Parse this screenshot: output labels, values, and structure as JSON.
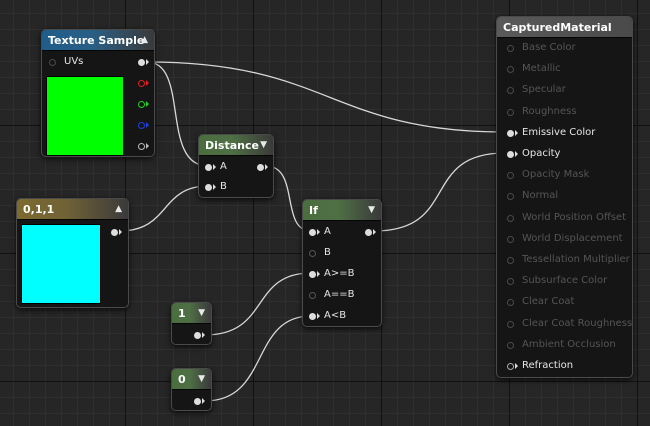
{
  "nodes": {
    "texture_sample": {
      "title": "Texture Sample",
      "input_uvs": "UVs",
      "preview_color": "#00ff00"
    },
    "distance": {
      "title": "Distance",
      "input_a": "A",
      "input_b": "B"
    },
    "constant3": {
      "title": "0,1,1",
      "preview_color": "#00ffff"
    },
    "if_node": {
      "title": "If",
      "inputs": [
        "A",
        "B",
        "A>=B",
        "A==B",
        "A<B"
      ]
    },
    "const_one": {
      "title": "1"
    },
    "const_zero": {
      "title": "0"
    },
    "material": {
      "title": "CapturedMaterial",
      "inputs": [
        "Base Color",
        "Metallic",
        "Specular",
        "Roughness",
        "Emissive Color",
        "Opacity",
        "Opacity Mask",
        "Normal",
        "World Position Offset",
        "World Displacement",
        "Tessellation Multiplier",
        "Subsurface Color",
        "Clear Coat",
        "Clear Coat Roughness",
        "Ambient Occlusion",
        "Refraction"
      ],
      "connected": [
        4,
        5,
        15
      ]
    }
  },
  "colors": {
    "wire": "#d8d8d8",
    "pin_r": "#e02020",
    "pin_g": "#20d020",
    "pin_b": "#2040e0",
    "pin_a": "#bbbbbb"
  }
}
